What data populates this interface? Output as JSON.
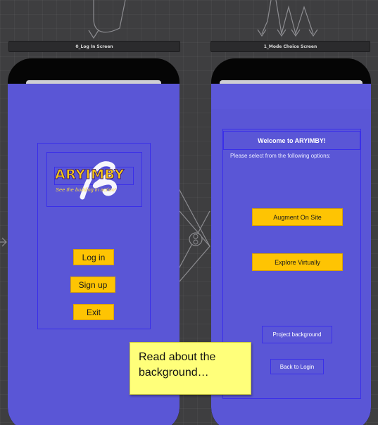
{
  "canvas": {
    "scenes": [
      {
        "label": "0_Log In Screen"
      },
      {
        "label": "1_Mode Choice Screen"
      }
    ]
  },
  "login_screen": {
    "logo_title": "ARYIMBY",
    "logo_subtitle": "See the building in action!",
    "buttons": {
      "login": "Log in",
      "signup": "Sign up",
      "exit": "Exit"
    }
  },
  "mode_screen": {
    "welcome": "Welcome to ARYIMBY!",
    "instruction": "Please select from the following options:",
    "buttons": {
      "augment": "Augment On Site",
      "explore": "Explore Virtually",
      "project_background": "Project background",
      "back_to_login": "Back to Login"
    }
  },
  "tooltip": {
    "line1": "Read about the",
    "line2": "background…"
  },
  "colors": {
    "screen_bg": "#5a56d6",
    "button_yellow": "#fec403",
    "outline_blue": "#3a2fe8",
    "tooltip_bg": "#ffff7a"
  },
  "icons": {
    "segue": "segue-circle-icon"
  }
}
